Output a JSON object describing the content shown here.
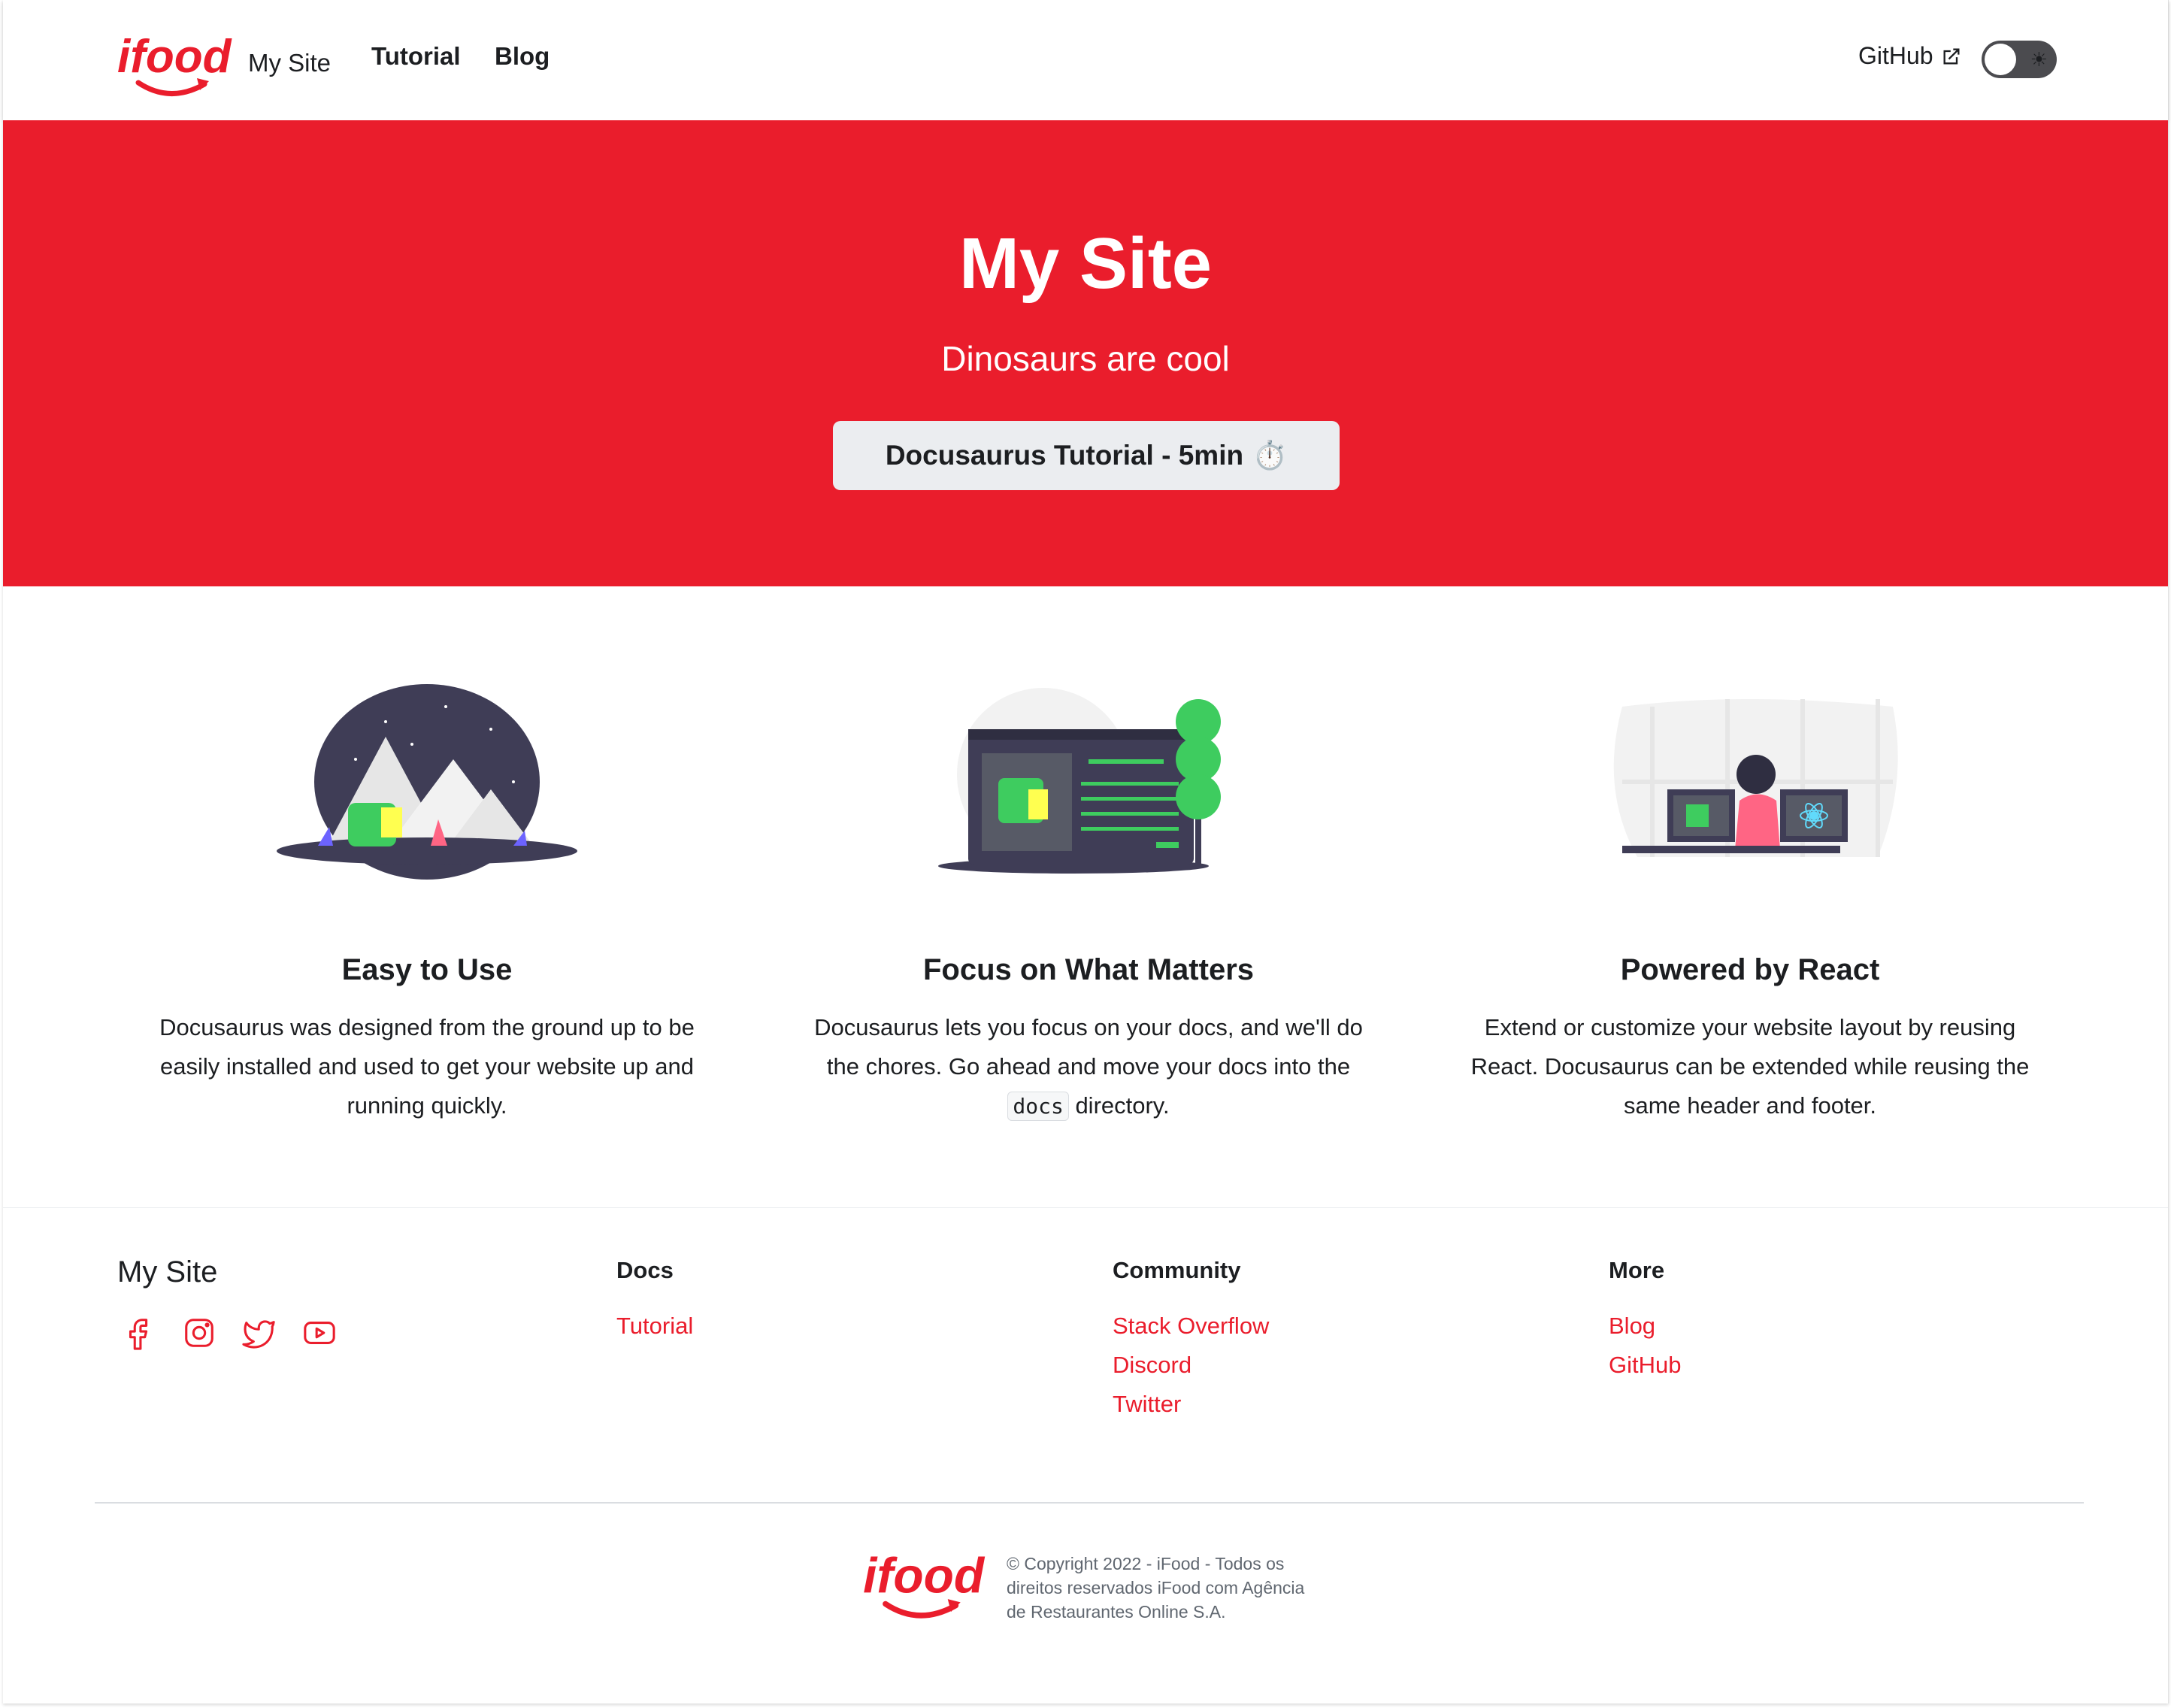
{
  "navbar": {
    "logo_text": "ifood",
    "title": "My Site",
    "links": [
      {
        "label": "Tutorial"
      },
      {
        "label": "Blog"
      }
    ],
    "github_label": "GitHub",
    "theme_toggle_icon": "sun-icon"
  },
  "hero": {
    "title": "My Site",
    "subtitle": "Dinosaurs are cool",
    "button_label": "Docusaurus Tutorial - 5min",
    "button_emoji": "⏱️",
    "background": "#ea1d2c"
  },
  "features": [
    {
      "title": "Easy to Use",
      "description": "Docusaurus was designed from the ground up to be easily installed and used to get your website up and running quickly."
    },
    {
      "title": "Focus on What Matters",
      "description_before": "Docusaurus lets you focus on your docs, and we'll do the chores. Go ahead and move your docs into the",
      "description_code": "docs",
      "description_after": "directory."
    },
    {
      "title": "Powered by React",
      "description": "Extend or customize your website layout by reusing React. Docusaurus can be extended while reusing the same header and footer."
    }
  ],
  "footer": {
    "brand": "My Site",
    "socials": [
      "facebook-icon",
      "instagram-icon",
      "twitter-icon",
      "youtube-icon"
    ],
    "columns": [
      {
        "title": "Docs",
        "links": [
          "Tutorial"
        ]
      },
      {
        "title": "Community",
        "links": [
          "Stack Overflow",
          "Discord",
          "Twitter"
        ]
      },
      {
        "title": "More",
        "links": [
          "Blog",
          "GitHub"
        ]
      }
    ],
    "copyright": "© Copyright 2022 - iFood - Todos os direitos reservados iFood com Agência de Restaurantes Online S.A."
  },
  "colors": {
    "brand_red": "#ea1d2c",
    "text": "#1c1e21",
    "muted": "#606770"
  }
}
